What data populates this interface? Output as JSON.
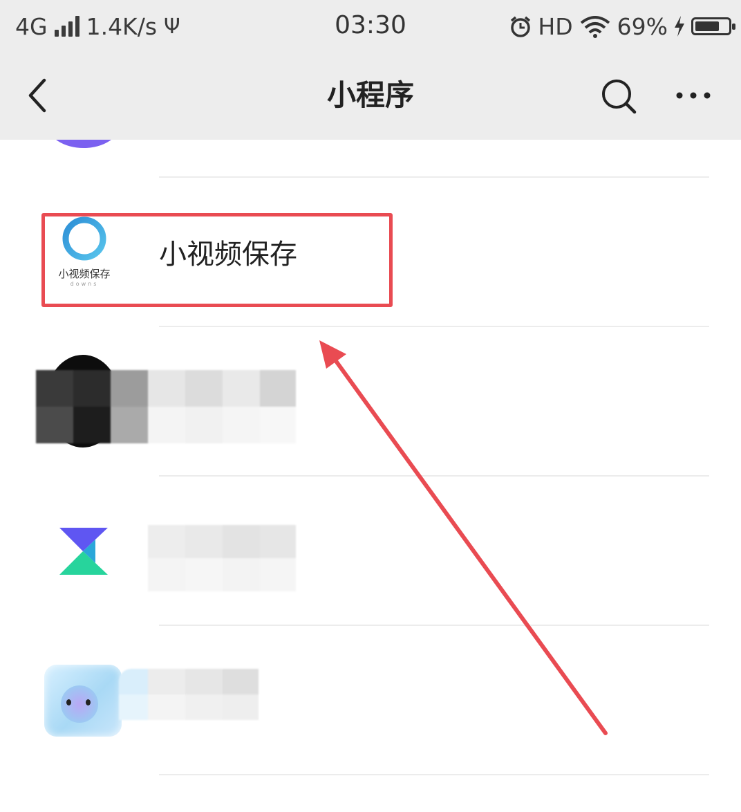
{
  "status_bar": {
    "network": "4G",
    "speed": "1.4K/s",
    "usb_symbol": "Ψ",
    "time": "03:30",
    "hd": "HD",
    "battery": "69%"
  },
  "header": {
    "title": "小程序"
  },
  "list": {
    "items": [
      {
        "name": "",
        "icon": "purple-circle-icon"
      },
      {
        "name": "小视频保存",
        "icon_text": "小视频保存",
        "icon_subtext": "downs",
        "icon": "blue-ring-logo-icon"
      },
      {
        "name": "",
        "icon": "black-circle-icon"
      },
      {
        "name": "",
        "icon": "xunlei-logo-icon"
      },
      {
        "name": "",
        "icon": "ice-cube-mascot-icon"
      }
    ]
  },
  "annotation": {
    "highlight_color": "#e94b52",
    "arrow_color": "#e94b52"
  },
  "colors": {
    "header_bg": "#ededed",
    "purple": "#7b61f0",
    "xunlei_blue": "#5f56f2",
    "xunlei_green": "#27d49c"
  }
}
